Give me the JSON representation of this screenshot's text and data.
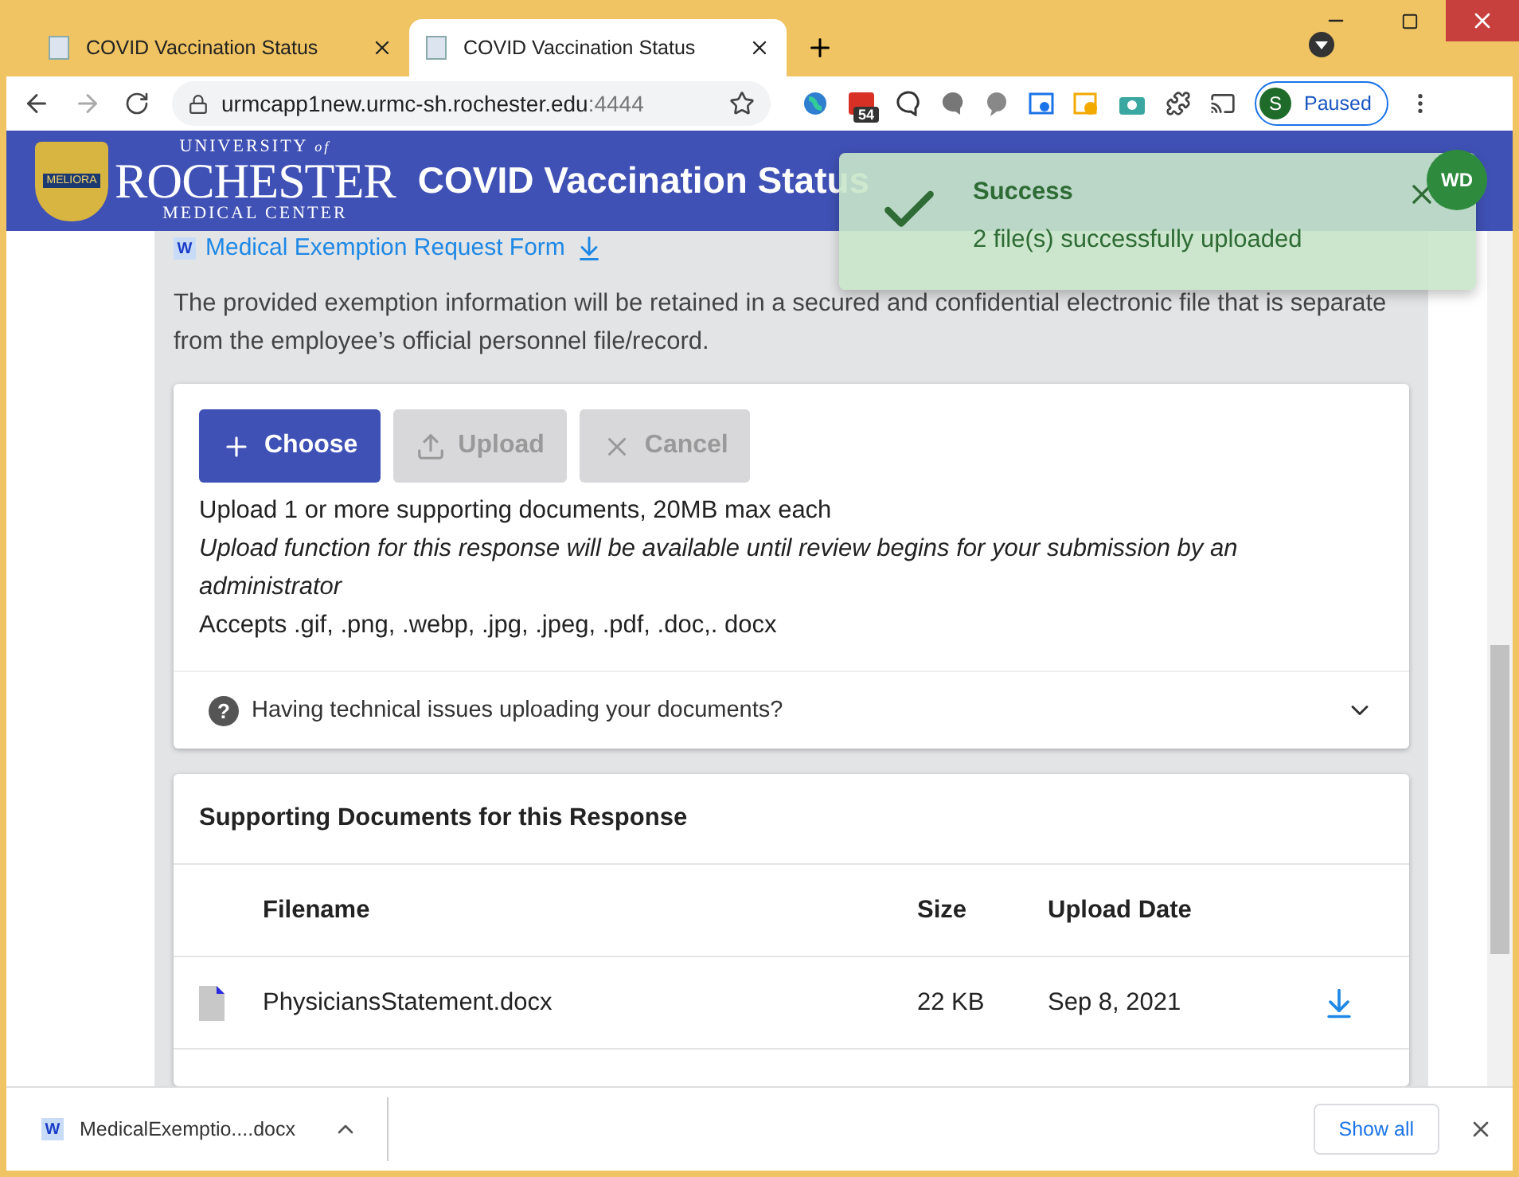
{
  "browser": {
    "tabs": [
      {
        "title": "COVID Vaccination Status",
        "selected": false
      },
      {
        "title": "COVID Vaccination Status",
        "selected": true
      }
    ],
    "address": {
      "host": "urmcapp1new.urmc-sh.rochester.edu",
      "port": ":4444"
    },
    "extension_badge": "54",
    "profile": {
      "initial": "S",
      "status": "Paused"
    }
  },
  "header": {
    "logo": {
      "top": "UNIVERSITY",
      "of": "of",
      "main": "ROCHESTER",
      "bottom": "MEDICAL CENTER",
      "motto": "MELIORA"
    },
    "title": "COVID Vaccination Status",
    "avatar": "WD"
  },
  "form_link_icon": "W",
  "form_link": "Medical Exemption Request Form",
  "notice": "The provided exemption information will be retained in a secured and confidential electronic file that is separate from the employee’s official personnel file/record.",
  "upload": {
    "buttons": [
      {
        "kind": "choose",
        "label": "Choose",
        "disabled": false
      },
      {
        "kind": "upload",
        "label": "Upload",
        "disabled": true
      },
      {
        "kind": "cancel",
        "label": "Cancel",
        "disabled": true
      }
    ],
    "lines": [
      {
        "text": "Upload 1 or more supporting documents, 20MB max each",
        "italic": false
      },
      {
        "text": "Upload function for this response will be available until review begins for your submission by an administrator",
        "italic": true
      },
      {
        "text": "Accepts .gif, .png, .webp, .jpg, .jpeg, .pdf, .doc,. docx",
        "italic": false
      }
    ]
  },
  "help": {
    "icon": "?",
    "text": "Having technical issues uploading your documents?",
    "expanded": false
  },
  "documents": {
    "title": "Supporting Documents for this Response",
    "columns": [
      "Filename",
      "Size",
      "Upload Date"
    ],
    "rows": [
      {
        "filename": "PhysiciansStatement.docx",
        "size": "22 KB",
        "date": "Sep 8, 2021"
      }
    ]
  },
  "toast": {
    "title": "Success",
    "message": "2 file(s) successfully uploaded"
  },
  "download_bar": {
    "icon": "W",
    "file": "MedicalExemptio....docx",
    "show_all": "Show all"
  }
}
